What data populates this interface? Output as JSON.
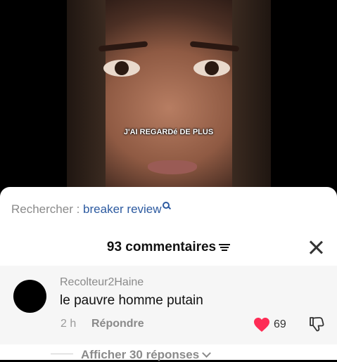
{
  "video": {
    "caption": "J'AI REGARDé DE PLUS"
  },
  "search": {
    "prefix": "Rechercher : ",
    "term": "breaker review",
    "icon": "search-icon"
  },
  "comments_header": {
    "count_label": "93 commentaires",
    "filter_icon": "filter-icon",
    "close_icon": "close-icon"
  },
  "comment": {
    "username": "Recolteur2Haine",
    "text": "le pauvre homme putain",
    "time": "2 h",
    "reply_label": "Répondre",
    "like_count": "69",
    "like_color": "#fe2c55",
    "dislike_icon": "thumbs-down-icon"
  },
  "replies": {
    "label": "Afficher 30 réponses"
  },
  "colors": {
    "search_term": "#2c5aa0"
  }
}
